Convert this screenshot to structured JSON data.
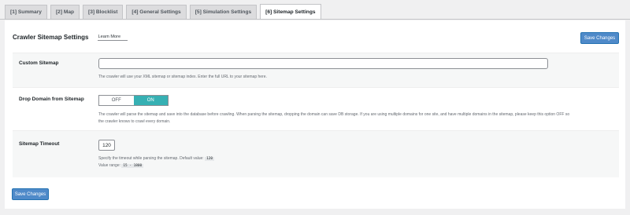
{
  "tabs": [
    {
      "label": "[1] Summary",
      "active": false
    },
    {
      "label": "[2] Map",
      "active": false
    },
    {
      "label": "[3] Blocklist",
      "active": false
    },
    {
      "label": "[4] General Settings",
      "active": false
    },
    {
      "label": "[5] Simulation Settings",
      "active": false
    },
    {
      "label": "[6] Sitemap Settings",
      "active": true
    }
  ],
  "header": {
    "title": "Crawler Sitemap Settings",
    "learn_more": "Learn More",
    "save_label": "Save Changes"
  },
  "custom_sitemap": {
    "label": "Custom Sitemap",
    "value": "",
    "description": "The crawler will use your XML sitemap or sitemap index. Enter the full URL to your sitemap here."
  },
  "drop_domain": {
    "label": "Drop Domain from Sitemap",
    "off_label": "OFF",
    "on_label": "ON",
    "selected": "ON",
    "description_line1": "The crawler will parse the sitemap and save into the database before crawling. When parsing the sitemap, dropping the domain can save DB storage. If you are using multiple domains for one site, and have multiple domains in the sitemap, please keep this option OFF so",
    "description_line2": "the crawler knows to crawl every domain."
  },
  "sitemap_timeout": {
    "label": "Sitemap Timeout",
    "value": "120",
    "description_prefix": "Specify the timeout while parsing the sitemap. Default value:",
    "default_value": "120",
    "range_prefix": "Value range:",
    "range_value": "15 - 1800"
  },
  "footer": {
    "save_label": "Save Changes"
  },
  "colors": {
    "primary_button": "#4f8ac9",
    "toggle_on": "#36b0b3"
  }
}
